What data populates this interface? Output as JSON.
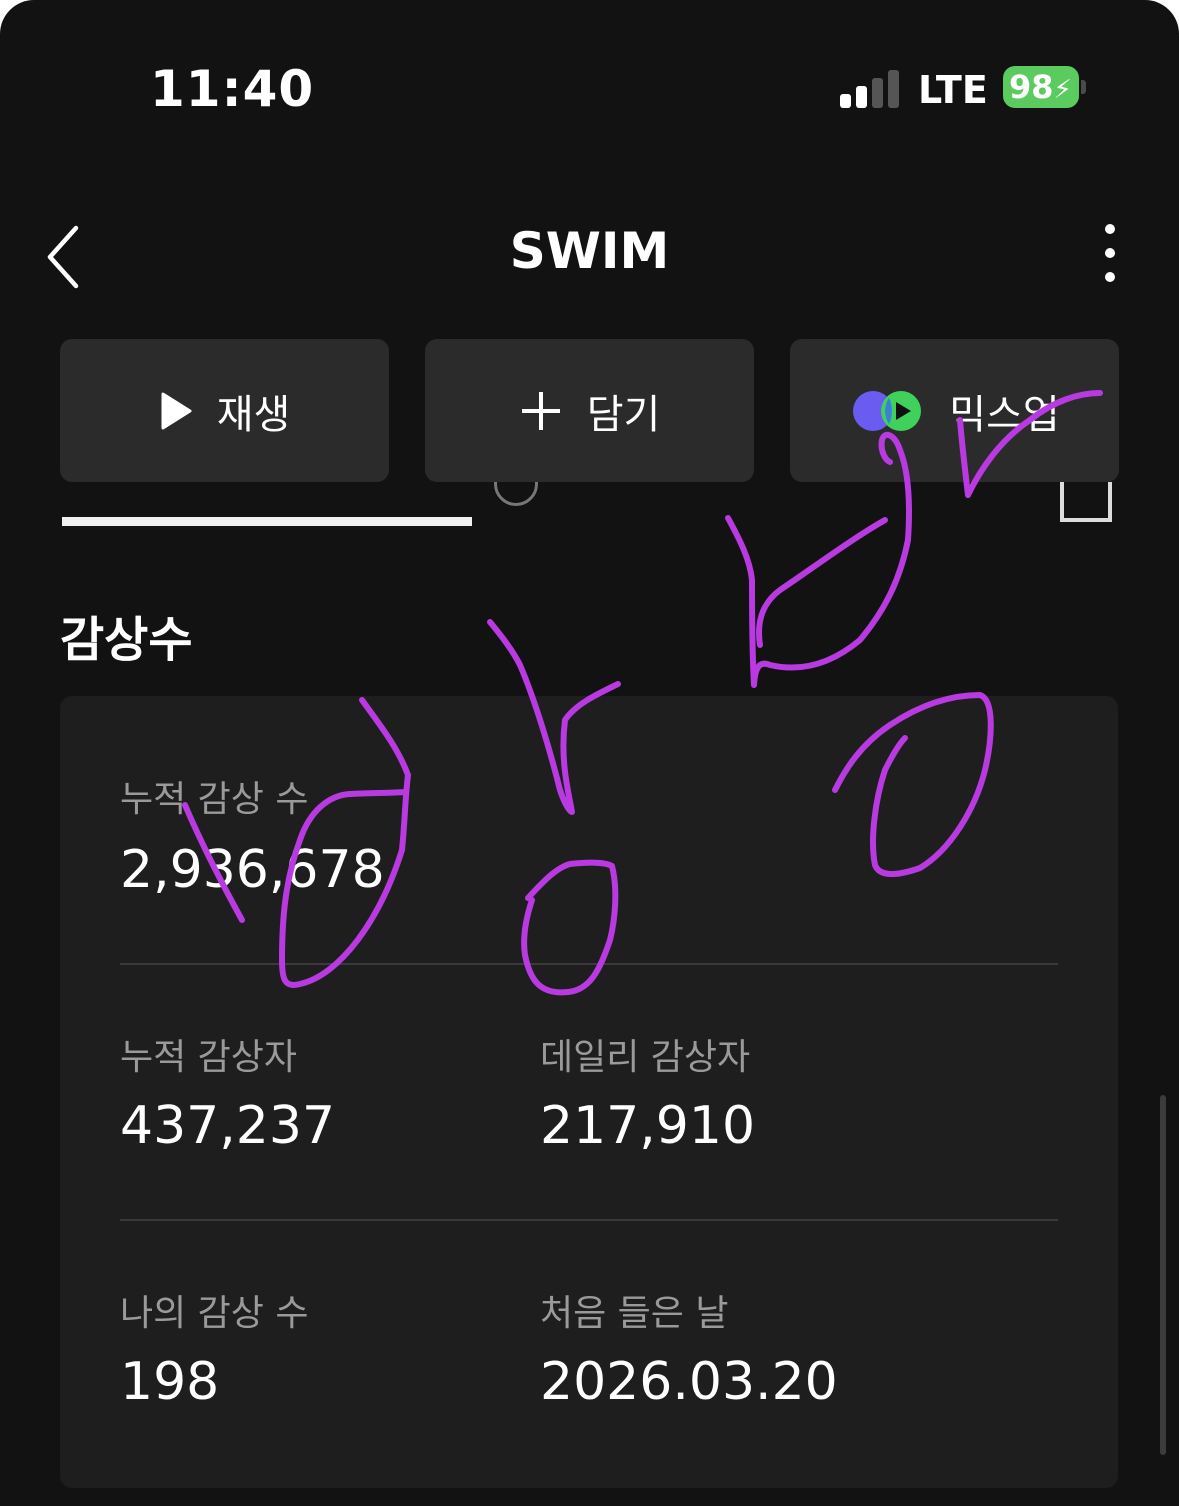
{
  "status_bar": {
    "time": "11:40",
    "network": "LTE",
    "battery": "98"
  },
  "header": {
    "title": "SWIM"
  },
  "actions": [
    {
      "label": "재생",
      "icon": "play-icon"
    },
    {
      "label": "담기",
      "icon": "plus-icon"
    },
    {
      "label": "믹스업",
      "icon": "mixup-icon"
    }
  ],
  "section": {
    "title": "감상수"
  },
  "stats": {
    "total_plays_label": "누적 감상 수",
    "total_plays_value": "2,936,678",
    "total_listeners_label": "누적 감상자",
    "total_listeners_value": "437,237",
    "daily_listeners_label": "데일리 감상자",
    "daily_listeners_value": "217,910",
    "my_plays_label": "나의 감상 수",
    "my_plays_value": "198",
    "first_listened_label": "처음 들은 날",
    "first_listened_value": "2026.03.20"
  },
  "colors": {
    "background": "#121212",
    "card": "#1e1e1e",
    "button": "#2b2b2b",
    "battery": "#5ccb5f",
    "annotation": "#b83ae0"
  }
}
